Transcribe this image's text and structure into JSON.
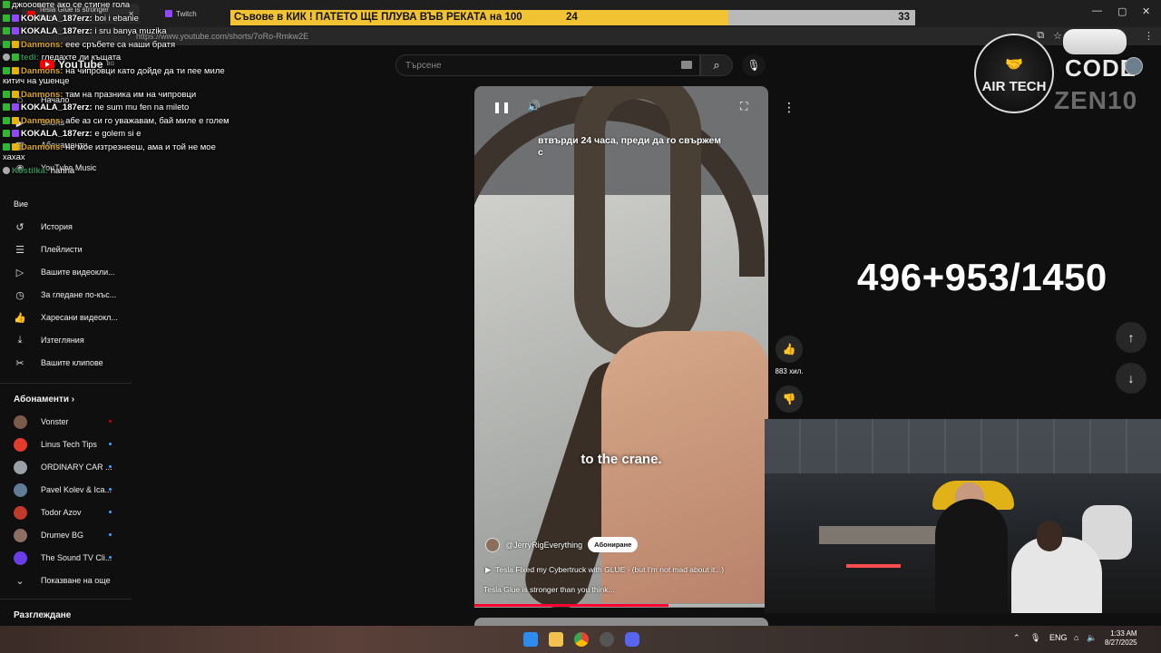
{
  "browser": {
    "tabs": [
      {
        "label": "Tesla Glue is stronger than"
      },
      {
        "label": "Twitch"
      }
    ],
    "url_prefix": "https://www.youtube.com",
    "url_path": "/shorts/7oRo-Rmkw2E",
    "window_controls": {
      "minimize": "—",
      "maximize": "▢",
      "close": "✕"
    }
  },
  "goal_bar": {
    "text": "Съвове в КИК ! ПАТЕТО ЩЕ ПЛУВА ВЪВ РЕКАТА на 100",
    "current": "24",
    "max": "33",
    "current_value": 24,
    "max_value": 33
  },
  "youtube": {
    "logo": "YouTube",
    "region": "BG",
    "search_placeholder": "Търсене",
    "sidebar_top": [
      {
        "label": "Начало",
        "icon": "home-icon",
        "glyph": "⌂"
      },
      {
        "label": "Shorts",
        "icon": "shorts-icon",
        "glyph": "▶"
      },
      {
        "label": "Абонаменти",
        "icon": "subscriptions-icon",
        "glyph": "▦"
      },
      {
        "label": "YouTube Music",
        "icon": "music-icon",
        "glyph": "◉"
      }
    ],
    "you_label": "Вие",
    "sidebar_you": [
      {
        "label": "История",
        "icon": "history-icon",
        "glyph": "↺"
      },
      {
        "label": "Плейлисти",
        "icon": "playlists-icon",
        "glyph": "☰"
      },
      {
        "label": "Вашите видеокли...",
        "icon": "your-videos-icon",
        "glyph": "▷"
      },
      {
        "label": "За гледане по-къс...",
        "icon": "watch-later-icon",
        "glyph": "◷"
      },
      {
        "label": "Харесани видеокл...",
        "icon": "liked-icon",
        "glyph": "👍"
      },
      {
        "label": "Изтегляния",
        "icon": "download-icon",
        "glyph": "⤓"
      },
      {
        "label": "Вашите клипове",
        "icon": "clips-icon",
        "glyph": "✂"
      }
    ],
    "subscriptions_heading": "Абонаменти",
    "subscriptions": [
      {
        "name": "Vonster",
        "color": "#7a5a4a"
      },
      {
        "name": "Linus Tech Tips",
        "color": "#e53b2c"
      },
      {
        "name": "ORDINARY CAR ...",
        "color": "#9aa0a6"
      },
      {
        "name": "Pavel Kolev & Ica...",
        "color": "#5f7d99"
      },
      {
        "name": "Todor Azov",
        "color": "#c0392b"
      },
      {
        "name": "Drumev BG",
        "color": "#8d6e63"
      },
      {
        "name": "The Sound TV Cli...",
        "color": "#6a3de8"
      }
    ],
    "show_more": "Показване на още",
    "explore_heading": "Разглеждане"
  },
  "chat": [
    {
      "user": "",
      "text": "джооовете ако се стигне гола",
      "badges": [
        "g"
      ]
    },
    {
      "user": "KOKALA_187erz:",
      "text": "boi i ebanie",
      "badges": [
        "g",
        "p"
      ],
      "cls": "u1"
    },
    {
      "user": "KOKALA_187erz:",
      "text": "i sru banya muzika",
      "badges": [
        "g",
        "p"
      ],
      "cls": "u1"
    },
    {
      "user": "Danmons:",
      "text": "еее сръбете са наши братя",
      "badges": [
        "g",
        "y"
      ],
      "cls": "u2"
    },
    {
      "user": "tedi:",
      "text": "гледахте ли къщата",
      "badges": [
        "s",
        "g"
      ],
      "cls": "u3"
    },
    {
      "user": "Danmons:",
      "text": "на чипровци като дойде да ти пее миле китич на ушенце",
      "badges": [
        "g",
        "y"
      ],
      "cls": "u2"
    },
    {
      "user": "Danmons:",
      "text": "там на празника им на чипровци",
      "badges": [
        "g",
        "y"
      ],
      "cls": "u2"
    },
    {
      "user": "KOKALA_187erz:",
      "text": "ne sum mu fen na mileto",
      "badges": [
        "g",
        "p"
      ],
      "cls": "u1"
    },
    {
      "user": "Danmons:",
      "text": "абе аз си го уважавам, бай миле е голем",
      "badges": [
        "g",
        "y"
      ],
      "cls": "u2"
    },
    {
      "user": "KOKALA_187erz:",
      "text": "e golem si e",
      "badges": [
        "g",
        "p"
      ],
      "cls": "u1"
    },
    {
      "user": "Danmons:",
      "text": "не мое изтрезнееш, ама и той не мое хахах",
      "badges": [
        "g",
        "y"
      ],
      "cls": "u2"
    },
    {
      "user": "Kostilka:",
      "text": "hahha",
      "badges": [
        "s"
      ],
      "cls": "u3"
    }
  ],
  "video": {
    "caption_top": "втвърди 24 часа, преди да го свържем с",
    "caption_bottom": "to the crane.",
    "channel": "@JerryRigEverything",
    "subscribe": "Абониране",
    "title": "Tesla Fixed my Cybertruck with GLUE - (but I'm not mad about it...)",
    "description": "Tesla Glue is stronger than you think...",
    "progress": 0.66,
    "likes": "883 хил."
  },
  "overlay": {
    "counter": "496+953/1450",
    "sponsor": "AIR TECH",
    "code_label": "CODE",
    "code": "ZEN10"
  },
  "taskbar": {
    "lang": "ENG",
    "time": "1:33 AM",
    "date": "8/27/2025"
  },
  "colors": {
    "yt_bg": "#0f0f0f",
    "goal_fill": "#f1c232",
    "goal_track": "#b9b9b9",
    "accent_red": "#ff0033"
  }
}
